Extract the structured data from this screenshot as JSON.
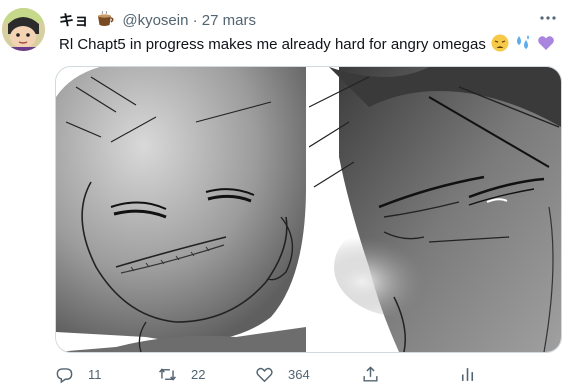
{
  "tweet": {
    "author_name": "キョ",
    "author_emoji_icon": "coffee-cup-icon",
    "handle": "@kyosein",
    "separator": "·",
    "date": "27 mars",
    "text": "Rl Chapt5 in progress makes me already hard for angry omegas",
    "text_emojis": [
      "weary-face-icon",
      "sweat-droplets-icon",
      "purple-heart-icon"
    ],
    "media": {
      "count": 2,
      "description_icons": [
        "manga-sketch-image-left",
        "manga-sketch-image-right"
      ]
    },
    "actions": {
      "reply_count": "11",
      "retweet_count": "22",
      "like_count": "364"
    }
  },
  "colors": {
    "text": "#0f1419",
    "secondary": "#536471",
    "border": "#cfd9de",
    "purple_heart": "#a985e0",
    "droplets": "#5dadec"
  }
}
